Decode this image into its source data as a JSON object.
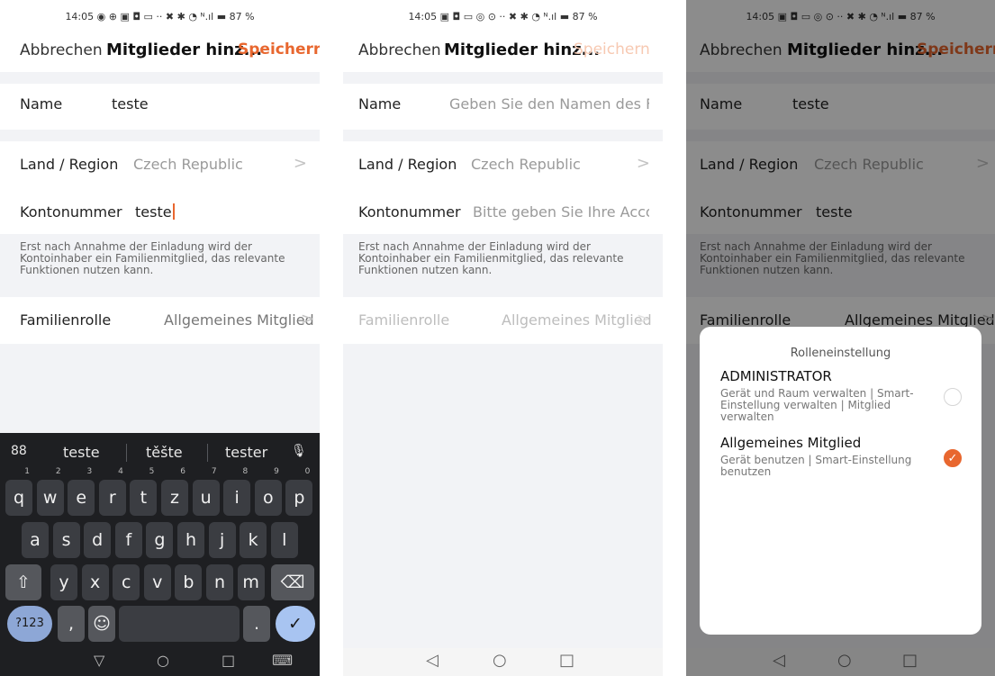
{
  "screen1": {
    "status": "14:05 ◉ ⊕ ▣ ◘ ▭ ·· ✖ ✱ ◔ ᴺ.ıl ▬ 87 %",
    "header": {
      "cancel": "Abbrechen",
      "title": "Mitglieder hinz...",
      "save": "Speichern"
    },
    "name": {
      "label": "Name",
      "value": "teste"
    },
    "region": {
      "label": "Land / Region",
      "value": "Czech Republic",
      "chevron": ">"
    },
    "account": {
      "label": "Kontonummer",
      "value": "teste"
    },
    "note": "Erst nach Annahme der Einladung wird der Kontoinhaber ein Familienmitglied, das relevante Funktionen nutzen kann.",
    "role": {
      "label": "Familienrolle",
      "value": "Allgemeines Mitglied",
      "chevron": ">"
    },
    "keyboard": {
      "grid_icon": "88",
      "suggestions": [
        "teste",
        "těšte",
        "tester"
      ],
      "mic_icon": "🎙",
      "row1": [
        {
          "k": "q",
          "h": "1"
        },
        {
          "k": "w",
          "h": "2"
        },
        {
          "k": "e",
          "h": "3"
        },
        {
          "k": "r",
          "h": "4"
        },
        {
          "k": "t",
          "h": "5"
        },
        {
          "k": "z",
          "h": "6"
        },
        {
          "k": "u",
          "h": "7"
        },
        {
          "k": "i",
          "h": "8"
        },
        {
          "k": "o",
          "h": "9"
        },
        {
          "k": "p",
          "h": "0"
        }
      ],
      "row2": [
        "a",
        "s",
        "d",
        "f",
        "g",
        "h",
        "j",
        "k",
        "l"
      ],
      "row3": [
        "y",
        "x",
        "c",
        "v",
        "b",
        "n",
        "m"
      ],
      "shift": "⇧",
      "backspace": "⌫",
      "num": "?123",
      "comma": ",",
      "emoji": "☺",
      "period": ".",
      "enter": "✓",
      "nav": [
        "▽",
        "○",
        "□",
        "⌨"
      ]
    }
  },
  "screen2": {
    "status": "14:05 ▣ ◘ ▭ ◎ ⊙ ·· ✖ ✱ ◔ ᴺ.ıl ▬ 87 %",
    "header": {
      "cancel": "Abbrechen",
      "title": "Mitglieder hinz...",
      "save": "Speichern"
    },
    "name": {
      "label": "Name",
      "placeholder": "Geben Sie den Namen des Fam"
    },
    "region": {
      "label": "Land / Region",
      "value": "Czech Republic",
      "chevron": ">"
    },
    "account": {
      "label": "Kontonummer",
      "placeholder": "Bitte geben Sie Ihre Accour"
    },
    "note": "Erst nach Annahme der Einladung wird der Kontoinhaber ein Familienmitglied, das relevante Funktionen nutzen kann.",
    "role": {
      "label": "Familienrolle",
      "value": "Allgemeines Mitglied",
      "chevron": ">"
    },
    "nav": [
      "◁",
      "○",
      "□"
    ]
  },
  "screen3": {
    "status": "14:05 ▣ ◘ ▭ ◎ ⊙ ·· ✖ ✱ ◔ ᴺ.ıl ▬ 87 %",
    "header": {
      "cancel": "Abbrechen",
      "title": "Mitglieder hinz...",
      "save": "Speichern"
    },
    "name": {
      "label": "Name",
      "value": "teste"
    },
    "region": {
      "label": "Land / Region",
      "value": "Czech Republic",
      "chevron": ">"
    },
    "account": {
      "label": "Kontonummer",
      "value": "teste"
    },
    "note": "Erst nach Annahme der Einladung wird der Kontoinhaber ein Familienmitglied, das relevante Funktionen nutzen kann.",
    "role": {
      "label": "Familienrolle",
      "value": "Allgemeines Mitglied",
      "chevron": ">"
    },
    "sheet": {
      "title": "Rolleneinstellung",
      "admin": {
        "title": "ADMINISTRATOR",
        "desc": "Gerät und Raum verwalten | Smart-Einstellung verwalten | Mitglied verwalten",
        "selected": false
      },
      "member": {
        "title": "Allgemeines Mitglied",
        "desc": "Gerät benutzen | Smart-Einstellung benutzen",
        "selected": true,
        "check": "✓"
      }
    },
    "nav": [
      "◁",
      "○",
      "□"
    ]
  },
  "colors": {
    "accent": "#e8672f",
    "band": "#f2f3f6",
    "keyboard": "#1e1f22"
  }
}
